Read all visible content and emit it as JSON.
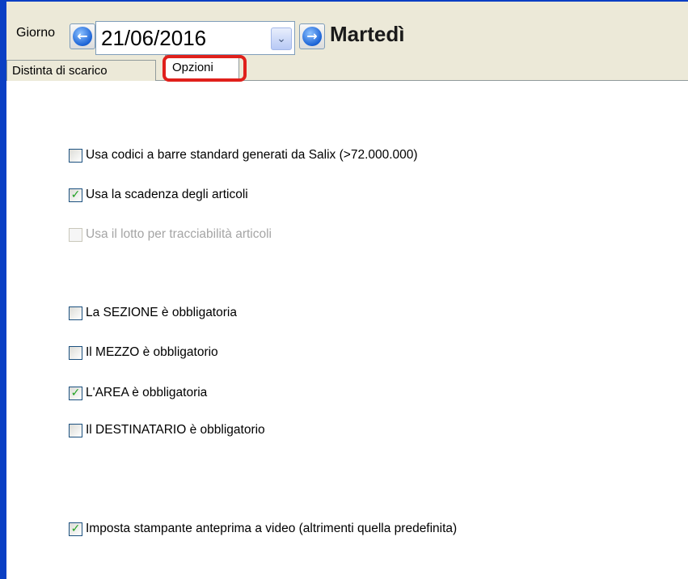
{
  "header": {
    "giorno_label": "Giorno",
    "prev_icon": "arrow-left-icon",
    "next_icon": "arrow-right-icon",
    "date_value": "21/06/2016",
    "dropdown_icon": "chevron-down-icon",
    "weekday": "Martedì"
  },
  "tabs": [
    {
      "label": "Distinta di scarico",
      "active": false
    },
    {
      "label": "Opzioni",
      "active": true
    }
  ],
  "options": [
    {
      "label": "Usa codici a barre standard generati da Salix (>72.000.000)",
      "checked": false,
      "enabled": true
    },
    {
      "label": "Usa la scadenza degli articoli",
      "checked": true,
      "enabled": true
    },
    {
      "label": "Usa il lotto per tracciabilità articoli",
      "checked": false,
      "enabled": false
    },
    {
      "label": "La SEZIONE è obbligatoria",
      "checked": false,
      "enabled": true
    },
    {
      "label": "Il MEZZO è obbligatorio",
      "checked": false,
      "enabled": true
    },
    {
      "label": "L'AREA è obbligatoria",
      "checked": true,
      "enabled": true
    },
    {
      "label": "Il DESTINATARIO è obbligatorio",
      "checked": false,
      "enabled": true
    },
    {
      "label": "Imposta stampante anteprima a video (altrimenti quella predefinita)",
      "checked": true,
      "enabled": true
    }
  ],
  "colors": {
    "window_border": "#0a3fc4",
    "highlight": "#e0201b",
    "check": "#21a121"
  }
}
